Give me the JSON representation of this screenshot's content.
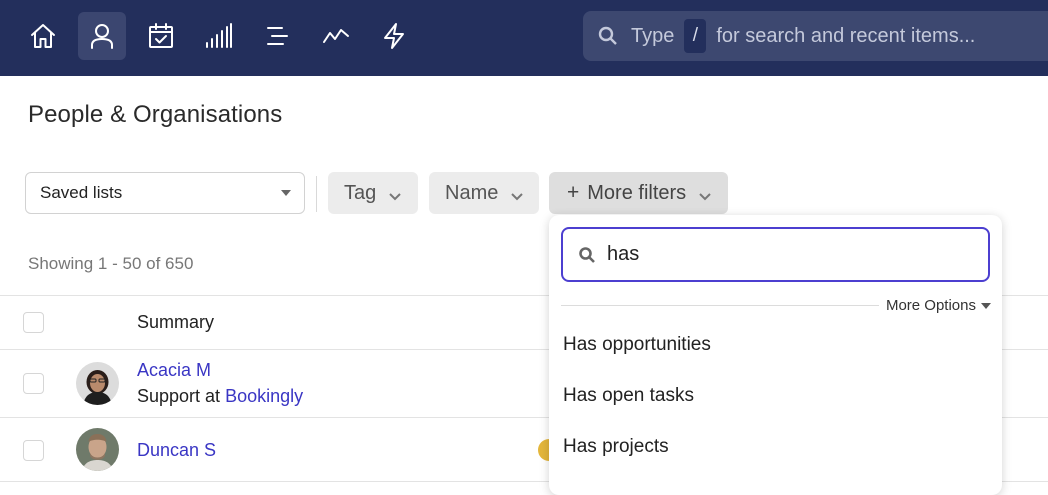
{
  "topbar": {
    "nav": [
      {
        "icon": "home-icon",
        "active": false
      },
      {
        "icon": "person-icon",
        "active": true
      },
      {
        "icon": "calendar-check-icon",
        "active": false
      },
      {
        "icon": "bar-signal-icon",
        "active": false
      },
      {
        "icon": "list-align-icon",
        "active": false
      },
      {
        "icon": "trend-line-icon",
        "active": false
      },
      {
        "icon": "lightning-icon",
        "active": false
      }
    ],
    "search": {
      "prefix": "Type",
      "shortcut": "/",
      "suffix": "for search and recent items..."
    }
  },
  "page": {
    "title": "People & Organisations",
    "saved_lists_label": "Saved lists",
    "filters": [
      "Tag",
      "Name"
    ],
    "more_filters_label": "More filters",
    "more_filters_plus": "+",
    "showing": "Showing 1 - 50 of 650",
    "table": {
      "header_summary": "Summary",
      "rows": [
        {
          "name": "Acacia M",
          "role_prefix": "Support at",
          "org": "Bookingly"
        },
        {
          "name": "Duncan S",
          "role_prefix": "",
          "org": ""
        }
      ]
    }
  },
  "dropdown": {
    "search_value": "has",
    "more_options_label": "More Options",
    "items": [
      "Has opportunities",
      "Has open tasks",
      "Has projects"
    ]
  },
  "colors": {
    "topbar": "#232f5c",
    "accent": "#4c3fd0",
    "link": "#3a36c4"
  }
}
